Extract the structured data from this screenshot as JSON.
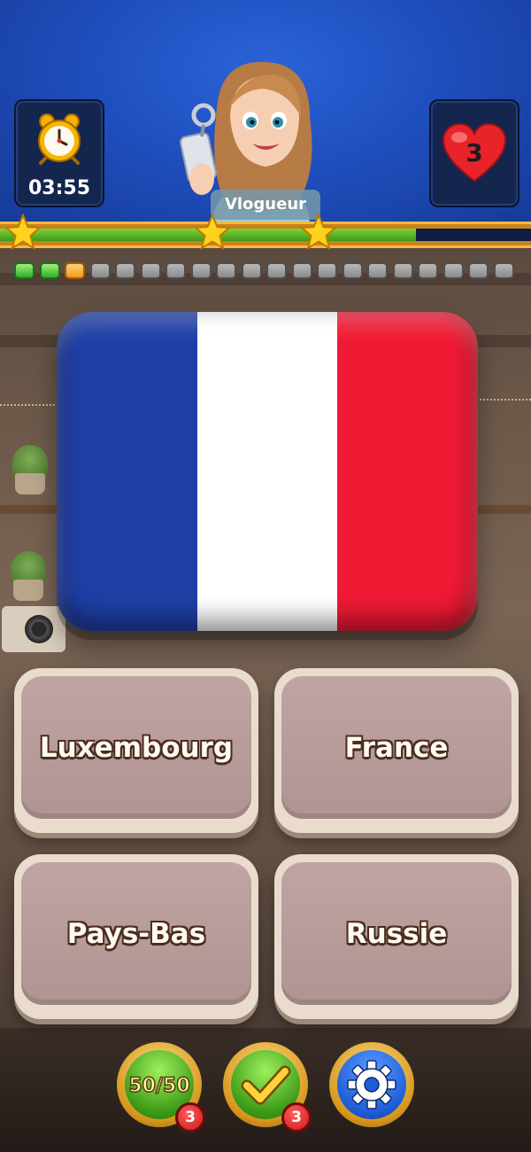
{
  "header": {
    "timer": "03:55",
    "lives": "3",
    "character_name": "Vlogueur"
  },
  "progress": {
    "fill_fraction": 0.783,
    "stars_earned": 3
  },
  "question_dots": {
    "total": 20,
    "done": 2,
    "current_index": 2
  },
  "question": {
    "flag_colors": [
      "#1f3fa6",
      "#ffffff",
      "#ef1a34"
    ]
  },
  "answers": [
    {
      "label": "Luxembourg"
    },
    {
      "label": "France"
    },
    {
      "label": "Pays-Bas"
    },
    {
      "label": "Russie"
    }
  ],
  "powerups": {
    "fifty_fifty": {
      "icon": "fifty-fifty-icon",
      "label": "50/50",
      "count": "3"
    },
    "correct_answer": {
      "icon": "checkmark-icon",
      "count": "3"
    },
    "settings": {
      "icon": "gear-icon"
    }
  },
  "colors": {
    "header_blue": "#1f4fbf",
    "progress_green": "#5fbf24",
    "answer_face": "#b89c9b",
    "answer_border": "#e9dccd"
  }
}
